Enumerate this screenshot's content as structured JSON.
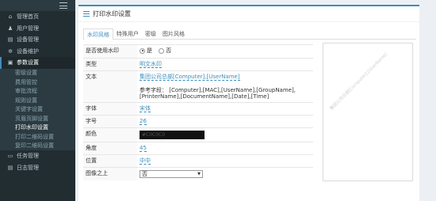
{
  "sidebar": {
    "items": [
      {
        "label": "管理首页",
        "icon": "home-icon",
        "glyph": "⌂"
      },
      {
        "label": "用户管理",
        "icon": "users-icon",
        "glyph": "♟"
      },
      {
        "label": "设备管理",
        "icon": "device-icon",
        "glyph": "▤"
      },
      {
        "label": "设备维护",
        "icon": "wrench-icon",
        "glyph": "✲"
      },
      {
        "label": "参数设置",
        "icon": "settings-icon",
        "glyph": "▣"
      }
    ],
    "submenu": [
      "密级设置",
      "费用管控",
      "审批流程",
      "规则设置",
      "关键字设置",
      "页眉页脚设置",
      "打印水印设置",
      "打印二维码设置",
      "复印二维码设置"
    ],
    "bottom_items": [
      {
        "label": "任务管理",
        "icon": "task-icon",
        "glyph": "▭"
      },
      {
        "label": "日志管理",
        "icon": "log-icon",
        "glyph": "▤"
      }
    ]
  },
  "main": {
    "title": "打印水印设置",
    "tabs": [
      "水印风格",
      "特殊用户",
      "密级",
      "图片风格"
    ],
    "form": {
      "enable_label": "是否使用水印",
      "enable_yes": "是",
      "enable_no": "否",
      "type_label": "类型",
      "type_value": "明文水印",
      "text_label": "文本",
      "text_value": "集团公司总部[Computer],[UserName]",
      "text_ref": "参考字段： [Computer],[MAC],[UserName],[GroupName],[PrinterName],[DocumentName],[Date],[Time]",
      "font_label": "字体",
      "font_value": "宋体",
      "size_label": "字号",
      "size_value": "26",
      "color_label": "颜色",
      "color_value": "#C0C0C0",
      "angle_label": "角度",
      "angle_value": "45",
      "position_label": "位置",
      "position_value": "中中",
      "above_image_label": "图像之上",
      "above_image_value": "否"
    },
    "preview_watermark": "集团公司总部[Computer],[UserName]"
  },
  "colors": {
    "accent": "#3c8dbc",
    "sidebar_bg": "#222d32",
    "watermark": "#C0C0C0"
  }
}
